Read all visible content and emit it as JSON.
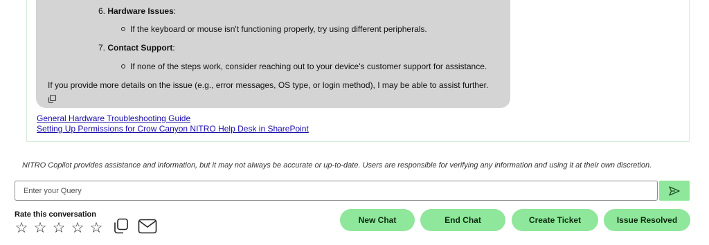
{
  "chat": {
    "steps": [
      {
        "number": "6.",
        "title": "Hardware Issues",
        "suffix": ":",
        "bullet": "If the keyboard or mouse isn't functioning properly, try using different peripherals."
      },
      {
        "number": "7.",
        "title": "Contact Support",
        "suffix": ":",
        "bullet": "If none of the steps work, consider reaching out to your device's customer support for assistance."
      }
    ],
    "closing": "If you provide more details on the issue (e.g., error messages, OS type, or login method), I may be able to assist further.",
    "links": [
      "General Hardware Troubleshooting Guide",
      "Setting Up Permissions for Crow Canyon NITRO Help Desk in SharePoint"
    ]
  },
  "disclaimer": "NITRO Copilot provides assistance and information, but it may not always be accurate or up-to-date. Users are responsible for verifying any information and using it at their own discretion.",
  "query": {
    "placeholder": "Enter your Query",
    "value": ""
  },
  "rating": {
    "label": "Rate this conversation",
    "stars": 5
  },
  "actions": {
    "new_chat": "New Chat",
    "end_chat": "End Chat",
    "create_ticket": "Create Ticket",
    "issue_resolved": "Issue Resolved"
  },
  "icons": [
    "copy-icon",
    "send-icon",
    "star-icon",
    "mail-icon"
  ],
  "colors": {
    "accent_green": "#8ee79a",
    "bubble_gray": "#d4d4d4",
    "link_blue": "#1a0dab"
  }
}
